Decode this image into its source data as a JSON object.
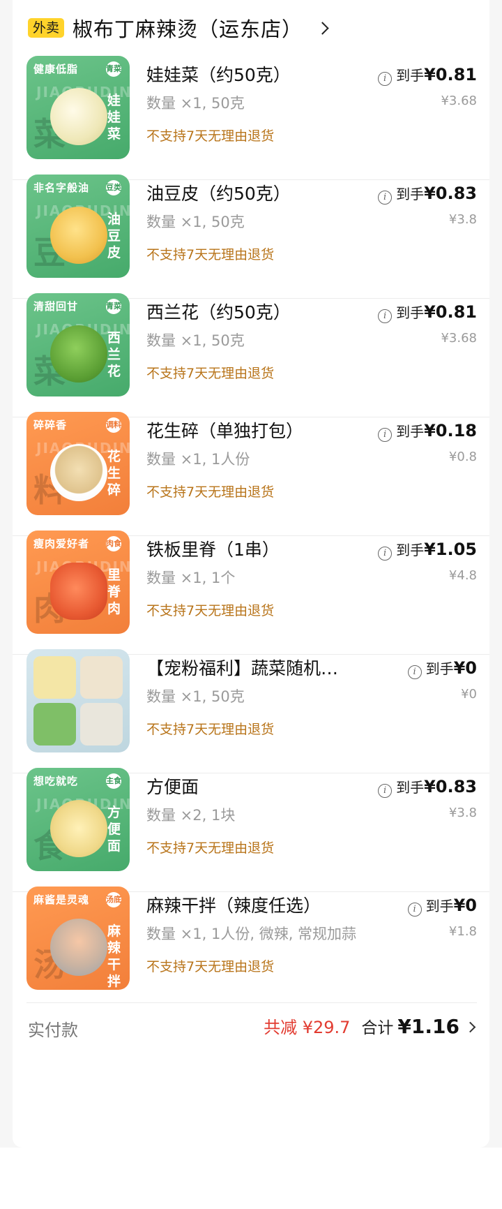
{
  "header": {
    "tag": "外卖",
    "store_name": "椒布丁麻辣烫（运东店）"
  },
  "items": [
    {
      "name": "娃娃菜（约50克）",
      "qty": "数量 ×1, 50克",
      "policy": "不支持7天无理由退货",
      "pay_label": "到手",
      "pay_price": "¥0.81",
      "orig_price": "¥3.68",
      "thumb_theme": "green"
    },
    {
      "name": "油豆皮（约50克）",
      "qty": "数量 ×1, 50克",
      "policy": "不支持7天无理由退货",
      "pay_label": "到手",
      "pay_price": "¥0.83",
      "orig_price": "¥3.8",
      "thumb_theme": "green"
    },
    {
      "name": "西兰花（约50克）",
      "qty": "数量 ×1, 50克",
      "policy": "不支持7天无理由退货",
      "pay_label": "到手",
      "pay_price": "¥0.81",
      "orig_price": "¥3.68",
      "thumb_theme": "green"
    },
    {
      "name": "花生碎（单独打包）",
      "qty": "数量 ×1, 1人份",
      "policy": "不支持7天无理由退货",
      "pay_label": "到手",
      "pay_price": "¥0.18",
      "orig_price": "¥0.8",
      "thumb_theme": "orange"
    },
    {
      "name": "铁板里脊（1串）",
      "qty": "数量 ×1, 1个",
      "policy": "不支持7天无理由退货",
      "pay_label": "到手",
      "pay_price": "¥1.05",
      "orig_price": "¥4.8",
      "thumb_theme": "orange"
    },
    {
      "name": "【宠粉福利】蔬菜随机（每...",
      "qty": "数量 ×1, 50克",
      "policy": "不支持7天无理由退货",
      "pay_label": "到手",
      "pay_price": "¥0",
      "orig_price": "¥0",
      "thumb_theme": "lightblue"
    },
    {
      "name": "方便面",
      "qty": "数量 ×2, 1块",
      "policy": "不支持7天无理由退货",
      "pay_label": "到手",
      "pay_price": "¥0.83",
      "orig_price": "¥3.8",
      "thumb_theme": "green"
    },
    {
      "name": "麻辣干拌（辣度任选）",
      "qty": "数量 ×1, 1人份, 微辣, 常规加蒜",
      "policy": "不支持7天无理由退货",
      "pay_label": "到手",
      "pay_price": "¥0",
      "orig_price": "¥1.8",
      "thumb_theme": "orange"
    }
  ],
  "thumbs": [
    {
      "slogan": "健康低脂",
      "badge": "青菜",
      "watermark": "JIAOBUDING",
      "vertical": "娃娃菜",
      "big": "菜"
    },
    {
      "slogan": "非名字般油",
      "badge": "豆类",
      "watermark": "JIAOBUDING",
      "vertical": "油豆皮",
      "big": "豆"
    },
    {
      "slogan": "清甜回甘",
      "badge": "青菜",
      "watermark": "JIAOBUDING",
      "vertical": "西兰花",
      "big": "菜"
    },
    {
      "slogan": "碎碎香",
      "badge": "调料",
      "watermark": "JIAOBUDING",
      "vertical": "花生碎",
      "big": "料"
    },
    {
      "slogan": "瘦肉爱好者",
      "badge": "肉食",
      "watermark": "JIAOBUDING",
      "vertical": "里脊肉",
      "big": "肉"
    },
    {
      "slogan": "",
      "badge": "",
      "watermark": "",
      "vertical": "",
      "big": ""
    },
    {
      "slogan": "想吃就吃",
      "badge": "主食",
      "watermark": "JIAOBUDING",
      "vertical": "方便面",
      "big": "食"
    },
    {
      "slogan": "麻酱是灵魂",
      "badge": "汤底",
      "watermark": "",
      "vertical": "麻辣干拌",
      "big": "汤"
    }
  ],
  "footer": {
    "paid_label": "实付款",
    "discount": "共减 ¥29.7",
    "total_label": "合计",
    "total_value": "¥1.16"
  },
  "colors": {
    "tag_bg": "#ffd32b",
    "policy_text": "#b8741a",
    "discount_text": "#e23b30",
    "thumb_green": "#4fb071",
    "thumb_orange": "#f5863f"
  }
}
